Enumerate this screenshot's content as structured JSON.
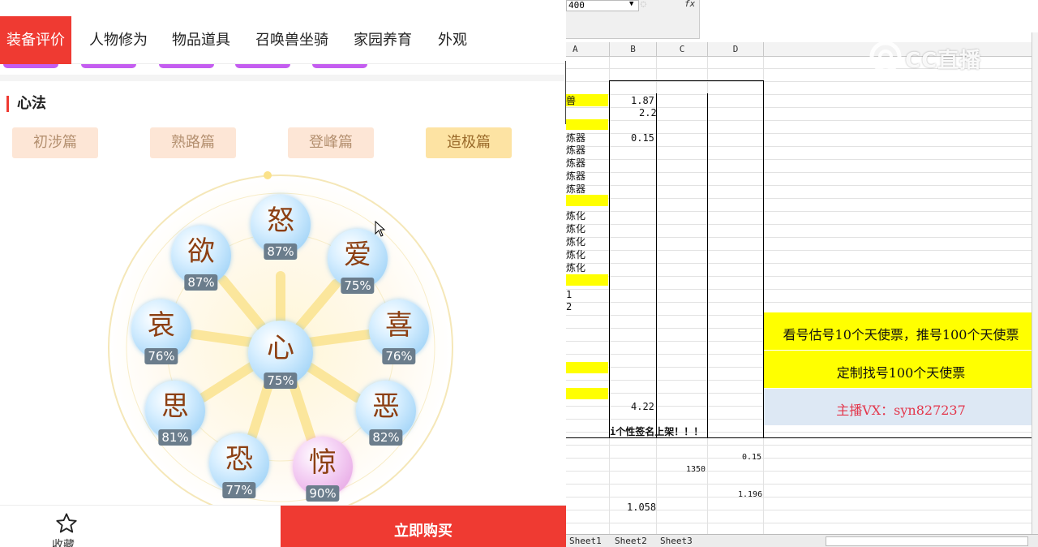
{
  "tabs": [
    "装备评价",
    "人物修为",
    "物品道具",
    "召唤兽坐骑",
    "家园养育",
    "外观"
  ],
  "section_title": "心法",
  "chapters": [
    "初涉篇",
    "熟路篇",
    "登峰篇",
    "造极篇"
  ],
  "selected_chapter": "造极篇",
  "orbs": [
    {
      "char": "怒",
      "pct": "87%"
    },
    {
      "char": "爱",
      "pct": "75%"
    },
    {
      "char": "喜",
      "pct": "76%"
    },
    {
      "char": "恶",
      "pct": "82%"
    },
    {
      "char": "惊",
      "pct": "90%"
    },
    {
      "char": "恐",
      "pct": "77%"
    },
    {
      "char": "思",
      "pct": "81%"
    },
    {
      "char": "哀",
      "pct": "76%"
    },
    {
      "char": "欲",
      "pct": "87%"
    },
    {
      "char": "心",
      "pct": "75%"
    }
  ],
  "bottom": {
    "favorite": "收藏",
    "buy": "立即购买"
  },
  "sheet": {
    "name_box": "400",
    "fx_label": "fx",
    "columns": [
      "A",
      "B",
      "C",
      "D"
    ],
    "a_cells": [
      "兽",
      "炼器",
      "炼器",
      "炼器",
      "炼器",
      "炼器",
      "炼化",
      "炼化",
      "炼化",
      "炼化",
      "炼化",
      "1",
      "2"
    ],
    "b_values": [
      "1.87",
      "2.2",
      "0.15",
      "4.22",
      "1.058"
    ],
    "c_value": "1350",
    "d_values": [
      "0.15",
      "1.196"
    ],
    "signature_text": "i个性签名上架！！！",
    "banner_1": "看号估号10个天使票，推号100个天使票",
    "banner_2": "定制找号100个天使票",
    "banner_3": "主播VX：syn827237",
    "sheet_tabs": [
      "Sheet1",
      "Sheet2",
      "Sheet3"
    ],
    "watermark": "CC直播"
  }
}
